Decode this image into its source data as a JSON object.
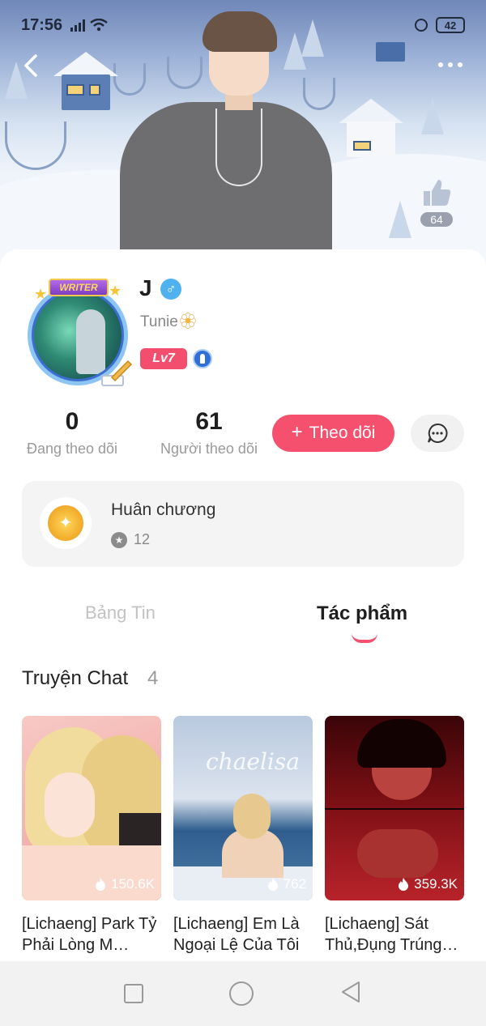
{
  "status_bar": {
    "time": "17:56",
    "battery": "42"
  },
  "header": {
    "likes": "64"
  },
  "profile": {
    "name": "J",
    "gender_symbol": "♂",
    "handle": "Tunie",
    "level": "Lv7",
    "avatar_badge": "WRITER"
  },
  "stats": {
    "following_count": "0",
    "following_label": "Đang theo dõi",
    "followers_count": "61",
    "followers_label": "Người theo dõi"
  },
  "actions": {
    "follow_label": "Theo dõi"
  },
  "medals": {
    "title": "Huân chương",
    "count": "12"
  },
  "tabs": [
    {
      "label": "Bảng Tin"
    },
    {
      "label": "Tác phẩm"
    }
  ],
  "section": {
    "title": "Truyện Chat",
    "count": "4"
  },
  "stories": [
    {
      "title": "[Lichaeng] Park Tỷ Phải Lòng M…",
      "views": "150.6K"
    },
    {
      "title": "[Lichaeng] Em Là Ngoại Lệ Của Tôi",
      "views": "762"
    },
    {
      "title": "[Lichaeng] Sát Thủ,Đụng Trúng…",
      "views": "359.3K"
    }
  ],
  "thumbnail_text": {
    "story2_script": "chaelisa"
  },
  "colors": {
    "accent": "#f5506d",
    "level_badge": "#f44e6e",
    "gender": "#4fb2ef"
  },
  "icons": [
    "back-arrow-icon",
    "more-dots-icon",
    "thumbs-up-icon",
    "male-icon",
    "flower-icon",
    "rank-icon",
    "plus-icon",
    "chat-bubble-icon",
    "medal-icon",
    "star-icon",
    "fire-icon",
    "nav-square-icon",
    "nav-circle-icon",
    "nav-back-triangle-icon"
  ]
}
